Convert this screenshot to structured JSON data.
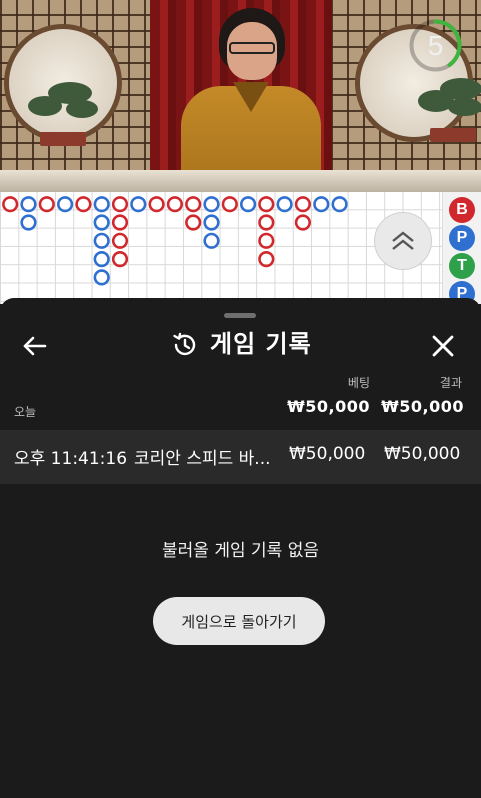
{
  "video": {
    "countdown": "5",
    "countdown_fraction": 0.4,
    "countdown_color": "#3fb43f"
  },
  "roadmap": {
    "colors": {
      "banker": "#d0282c",
      "player": "#2e6fd0",
      "tie": "#2fa04a"
    },
    "bead_columns": [
      [
        "B"
      ],
      [
        "P",
        "P"
      ],
      [
        "B"
      ],
      [
        "P"
      ],
      [
        "B"
      ],
      [
        "P",
        "P",
        "P",
        "P",
        "P"
      ],
      [
        "B",
        "B",
        "B",
        "B"
      ],
      [
        "P"
      ],
      [
        "B"
      ],
      [
        "B"
      ],
      [
        "B",
        "B"
      ],
      [
        "P",
        "P",
        "P"
      ],
      [
        "B"
      ],
      [
        "P"
      ],
      [
        "B",
        "B",
        "B",
        "B"
      ],
      [
        "P"
      ],
      [
        "B",
        "B"
      ],
      [
        "P"
      ],
      [
        "P"
      ]
    ],
    "scroll_up_icon": "double-chevron-up-icon",
    "side_chips": [
      {
        "letter": "B",
        "color": "#d0282c"
      },
      {
        "letter": "P",
        "color": "#2e6fd0"
      },
      {
        "letter": "T",
        "color": "#2fa04a"
      },
      {
        "letter": "P",
        "color": "#2e6fd0"
      }
    ]
  },
  "sheet": {
    "title": "게임 기록",
    "back_icon": "arrow-left-icon",
    "history_icon": "history-icon",
    "close_icon": "close-icon",
    "col_bet": "베팅",
    "col_result": "결과",
    "today_label": "오늘",
    "today_bet_total": "₩50,000",
    "today_result_total": "₩50,000",
    "rows": [
      {
        "time": "오후 11:41:16",
        "game": "코리안 스피드 바...",
        "bet": "₩50,000",
        "result": "₩50,000"
      }
    ],
    "empty_message": "불러올 게임 기록 없음",
    "return_button": "게임으로 돌아가기"
  }
}
